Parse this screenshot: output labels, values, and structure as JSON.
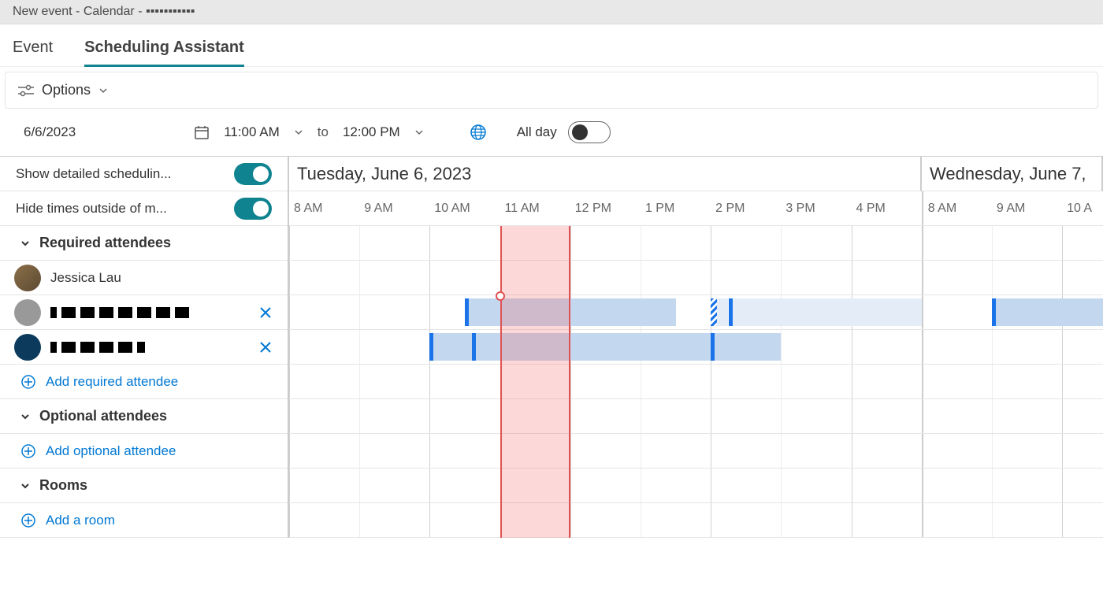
{
  "titlebar": "New event - Calendar - ▪▪▪▪▪▪▪▪▪▪▪",
  "tabs": {
    "event": "Event",
    "scheduling": "Scheduling Assistant"
  },
  "toolbar": {
    "options": "Options"
  },
  "date_row": {
    "date": "6/6/2023",
    "start_time": "11:00 AM",
    "to": "to",
    "end_time": "12:00 PM",
    "all_day": "All day",
    "all_day_on": false
  },
  "settings": {
    "detailed": {
      "label": "Show detailed schedulin...",
      "on": true
    },
    "hide_outside": {
      "label": "Hide times outside of m...",
      "on": true
    }
  },
  "sections": {
    "required": "Required attendees",
    "optional": "Optional attendees",
    "rooms": "Rooms"
  },
  "attendees": {
    "required": [
      {
        "name": "Jessica Lau",
        "removable": false,
        "avatar": "photo"
      },
      {
        "name": "▪▪▪▪▪▪▪▪▪▪",
        "removable": true,
        "avatar": "gray"
      },
      {
        "name": "▪▪▪▪▪▪",
        "removable": true,
        "avatar": "dark"
      }
    ]
  },
  "add_links": {
    "required": "Add required attendee",
    "optional": "Add optional attendee",
    "room": "Add a room"
  },
  "days": [
    {
      "label": "Tuesday, June 6, 2023",
      "hours": [
        "8 AM",
        "9 AM",
        "10 AM",
        "11 AM",
        "12 PM",
        "1 PM",
        "2 PM",
        "3 PM",
        "4 PM"
      ]
    },
    {
      "label": "Wednesday, June 7,",
      "hours": [
        "8 AM",
        "9 AM",
        "10 A"
      ]
    }
  ],
  "busy": {
    "row1": [
      {
        "start_hour": 10.5,
        "end_hour": 13.5,
        "tentative": false
      },
      {
        "start_hour": 14.0,
        "end_hour": 14.25,
        "tentative": true
      },
      {
        "start_hour": 14.25,
        "end_hour": 17.0,
        "tentative": false,
        "light": true
      }
    ],
    "row1_day2": [
      {
        "start_hour": 9.0,
        "end_hour": 12.0,
        "tentative": false
      }
    ],
    "row2": [
      {
        "start_hour": 10.0,
        "end_hour": 10.6,
        "tentative": false
      },
      {
        "start_hour": 10.6,
        "end_hour": 14.0,
        "tentative": false
      },
      {
        "start_hour": 14.0,
        "end_hour": 15.0,
        "tentative": false
      }
    ]
  },
  "selection": {
    "start_hour": 11.0,
    "end_hour": 12.0
  },
  "colors": {
    "accent_teal": "#0f8390",
    "link": "#0078d4",
    "busy": "#c3d7ef",
    "busy_border": "#1a73e8",
    "sel": "#e05252"
  }
}
